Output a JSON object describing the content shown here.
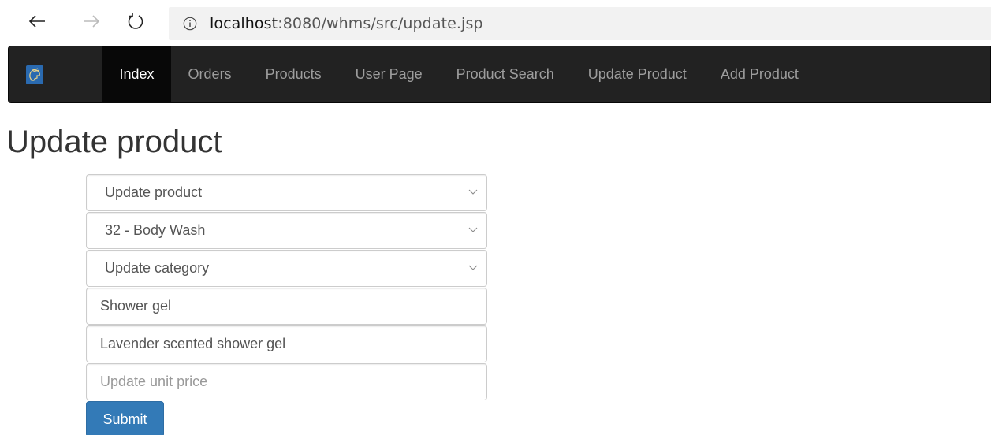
{
  "browser": {
    "url_host": "localhost",
    "url_rest": ":8080/whms/src/update.jsp"
  },
  "navbar": {
    "brand_icon": "spartan-helmet-logo",
    "items": [
      {
        "label": "Index",
        "active": true
      },
      {
        "label": "Orders"
      },
      {
        "label": "Products"
      },
      {
        "label": "User Page"
      },
      {
        "label": "Product Search"
      },
      {
        "label": "Update Product"
      },
      {
        "label": "Add Product"
      }
    ]
  },
  "page": {
    "title": "Update product"
  },
  "form": {
    "update_product_select": "Update product",
    "product_select": "32 - Body Wash",
    "category_select": "Update category",
    "name_value": "Shower gel",
    "description_value": "Lavender scented shower gel",
    "unit_price_placeholder": "Update unit price",
    "submit_label": "Submit"
  },
  "colors": {
    "navbar_bg": "#222222",
    "nav_active_bg": "#080808",
    "primary_button": "#337ab7"
  }
}
